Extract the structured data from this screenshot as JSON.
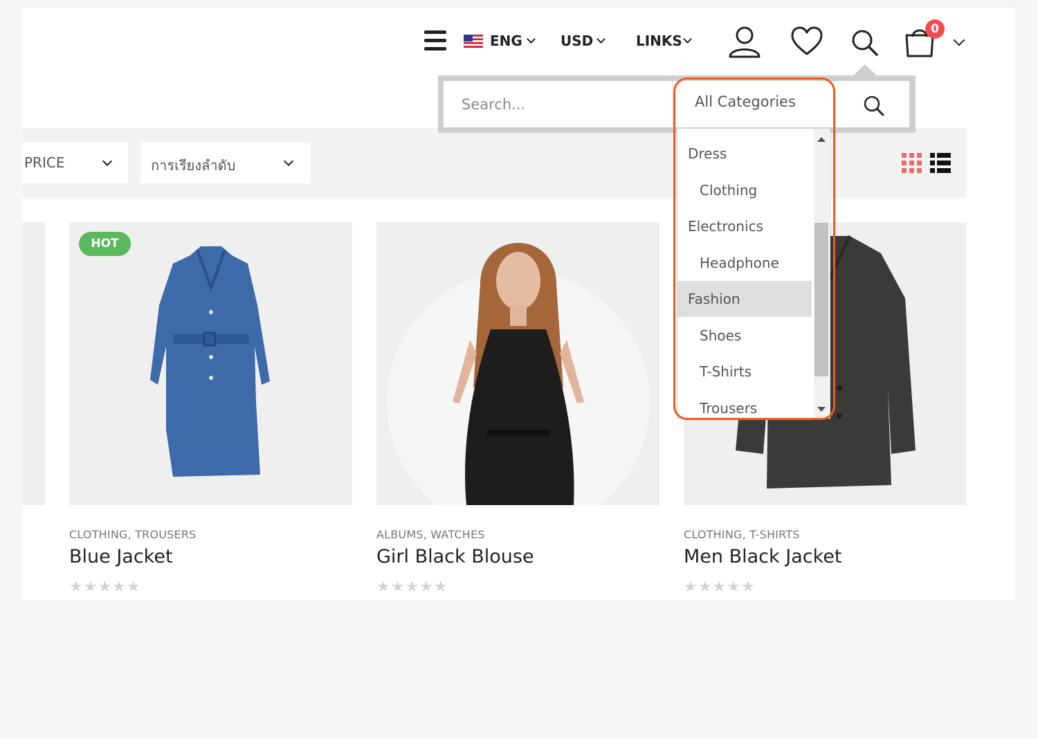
{
  "header": {
    "language": "ENG",
    "currency": "USD",
    "links": "LINKS",
    "cart_count": "0"
  },
  "search": {
    "placeholder": "Search...",
    "category_label": "All Categories"
  },
  "category_dropdown": {
    "items": [
      {
        "label": "Dress",
        "level": 0
      },
      {
        "label": "Clothing",
        "level": 1
      },
      {
        "label": "Electronics",
        "level": 0
      },
      {
        "label": "Headphone",
        "level": 1
      },
      {
        "label": "Fashion",
        "level": 0,
        "selected": true
      },
      {
        "label": "Shoes",
        "level": 1
      },
      {
        "label": "T-Shirts",
        "level": 1
      },
      {
        "label": "Trousers",
        "level": 1
      }
    ]
  },
  "filters": {
    "price_label": "PRICE",
    "sort_label": "การเรียงลำดับ"
  },
  "colors": {
    "highlight": "#f15a1a",
    "hot_badge": "#5cb85c",
    "cart_badge": "#f04d4d",
    "grid_icon": "#f06a6a"
  },
  "products": [
    {
      "badge": "HOT",
      "categories": "CLOTHING, TROUSERS",
      "title": "Blue Jacket",
      "rating": 0
    },
    {
      "badge": "",
      "categories": "ALBUMS, WATCHES",
      "title": "Girl Black Blouse",
      "rating": 0
    },
    {
      "badge": "",
      "categories": "CLOTHING, T-SHIRTS",
      "title": "Men Black Jacket",
      "rating": 0
    }
  ]
}
